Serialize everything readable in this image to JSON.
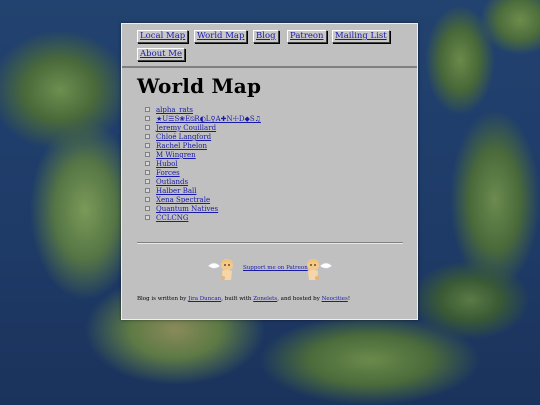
{
  "nav": {
    "items": [
      {
        "label": "Local Map"
      },
      {
        "label": "World Map"
      },
      {
        "label": "Blog"
      },
      {
        "label": "Patreon"
      },
      {
        "label": "Mailing List"
      },
      {
        "label": "About Me"
      }
    ]
  },
  "page_title": "World Map",
  "links": [
    "alpha_rats",
    "★U☰S❀E⍉R◐L⚲A✚N☩D◆S♫",
    "Jeremy Couillard",
    "Chloé Langford",
    "Rachel Phelon",
    "M Wingren",
    "Hubol",
    "Forces",
    "Outlands",
    "Halber Ball",
    "Xena Spectrale",
    "Quantum Natives",
    "CCLCNG"
  ],
  "support": {
    "label": "Support me on Patreon"
  },
  "footer": {
    "prefix": "Blog is written by ",
    "author": "Jira Duncan",
    "mid1": ", built with ",
    "tool": "Zonelets",
    "mid2": ", and hosted by ",
    "host": "Neocities",
    "suffix": "!"
  },
  "colors": {
    "panel_bg": "#c0c0c0",
    "link": "#1a1aa8",
    "ocean": "#1e3a6b"
  }
}
